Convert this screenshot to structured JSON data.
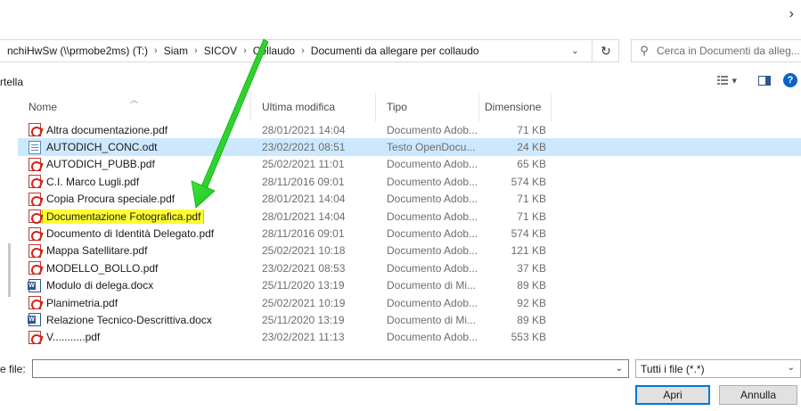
{
  "window": {
    "close_glyph": "›"
  },
  "address": {
    "crumbs": [
      "nchiHwSw (\\\\prmobe2ms) (T:)",
      "Siam",
      "SICOV",
      "Collaudo",
      "Documenti da allegare per collaudo"
    ],
    "separator": "›",
    "dropdown_glyph": "⌄",
    "refresh_glyph": "↻"
  },
  "search": {
    "placeholder": "Cerca in Documenti da alleg..."
  },
  "toolbar": {
    "left_label": "rtella",
    "view_caret": "▾",
    "help_glyph": "?"
  },
  "columns": {
    "name": "Nome",
    "date": "Ultima modifica",
    "type": "Tipo",
    "size": "Dimensione"
  },
  "files": [
    {
      "icon": "pdf",
      "name": "Altra documentazione.pdf",
      "date": "28/01/2021 14:04",
      "type": "Documento Adob...",
      "size": "71 KB"
    },
    {
      "icon": "odt",
      "name": "AUTODICH_CONC.odt",
      "date": "23/02/2021 08:51",
      "type": "Testo OpenDocu...",
      "size": "24 KB",
      "selected": true
    },
    {
      "icon": "pdf",
      "name": "AUTODICH_PUBB.pdf",
      "date": "25/02/2021 11:01",
      "type": "Documento Adob...",
      "size": "65 KB"
    },
    {
      "icon": "pdf",
      "name": "C.I. Marco Lugli.pdf",
      "date": "28/11/2016 09:01",
      "type": "Documento Adob...",
      "size": "574 KB"
    },
    {
      "icon": "pdf",
      "name": "Copia Procura speciale.pdf",
      "date": "28/01/2021 14:04",
      "type": "Documento Adob...",
      "size": "71 KB"
    },
    {
      "icon": "pdf",
      "name": "Documentazione Fotografica.pdf",
      "date": "28/01/2021 14:04",
      "type": "Documento Adob...",
      "size": "71 KB",
      "highlighted": true
    },
    {
      "icon": "pdf",
      "name": "Documento di Identità Delegato.pdf",
      "date": "28/11/2016 09:01",
      "type": "Documento Adob...",
      "size": "574 KB"
    },
    {
      "icon": "pdf",
      "name": "Mappa Satellitare.pdf",
      "date": "25/02/2021 10:18",
      "type": "Documento Adob...",
      "size": "121 KB"
    },
    {
      "icon": "pdf",
      "name": "MODELLO_BOLLO.pdf",
      "date": "23/02/2021 08:53",
      "type": "Documento Adob...",
      "size": "37 KB"
    },
    {
      "icon": "doc",
      "name": "Modulo di delega.docx",
      "date": "25/11/2020 13:19",
      "type": "Documento di Mi...",
      "size": "89 KB"
    },
    {
      "icon": "pdf",
      "name": "Planimetria.pdf",
      "date": "25/02/2021 10:19",
      "type": "Documento Adob...",
      "size": "92 KB"
    },
    {
      "icon": "doc",
      "name": "Relazione Tecnico-Descrittiva.docx",
      "date": "25/11/2020 13:19",
      "type": "Documento di Mi...",
      "size": "89 KB"
    },
    {
      "icon": "pdf",
      "name": "V...........pdf",
      "date": "23/02/2021 11:13",
      "type": "Documento Adob...",
      "size": "553 KB"
    }
  ],
  "filename": {
    "label": "e file:",
    "value": "",
    "dropdown_glyph": "⌄"
  },
  "filetype": {
    "value": "Tutti i file (*.*)",
    "dropdown_glyph": "⌄"
  },
  "buttons": {
    "open": "Apri",
    "cancel": "Annulla"
  },
  "colors": {
    "annotation_arrow": "#2bd92b",
    "highlight": "#ffff33",
    "selection": "#cce8ff"
  }
}
